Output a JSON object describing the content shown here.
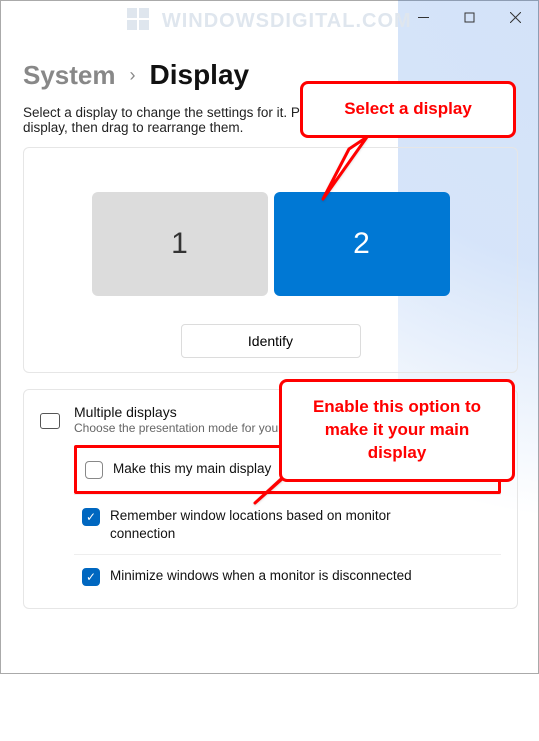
{
  "watermark": "WINDOWSDIGITAL.COM",
  "breadcrumb": {
    "system": "System",
    "display": "Display"
  },
  "subtitle": "Select a display to change the settings for it. Press and hold (or select) a display, then drag to rearrange them.",
  "monitors": {
    "m1": "1",
    "m2": "2"
  },
  "identify_label": "Identify",
  "multi": {
    "title": "Multiple displays",
    "desc": "Choose the presentation mode for your displays"
  },
  "options": {
    "main": "Make this my main display",
    "remember": "Remember window locations based on monitor connection",
    "minimize": "Minimize windows when a monitor is disconnected"
  },
  "callout1": "Select a display",
  "callout2": "Enable this option to make it your main display"
}
